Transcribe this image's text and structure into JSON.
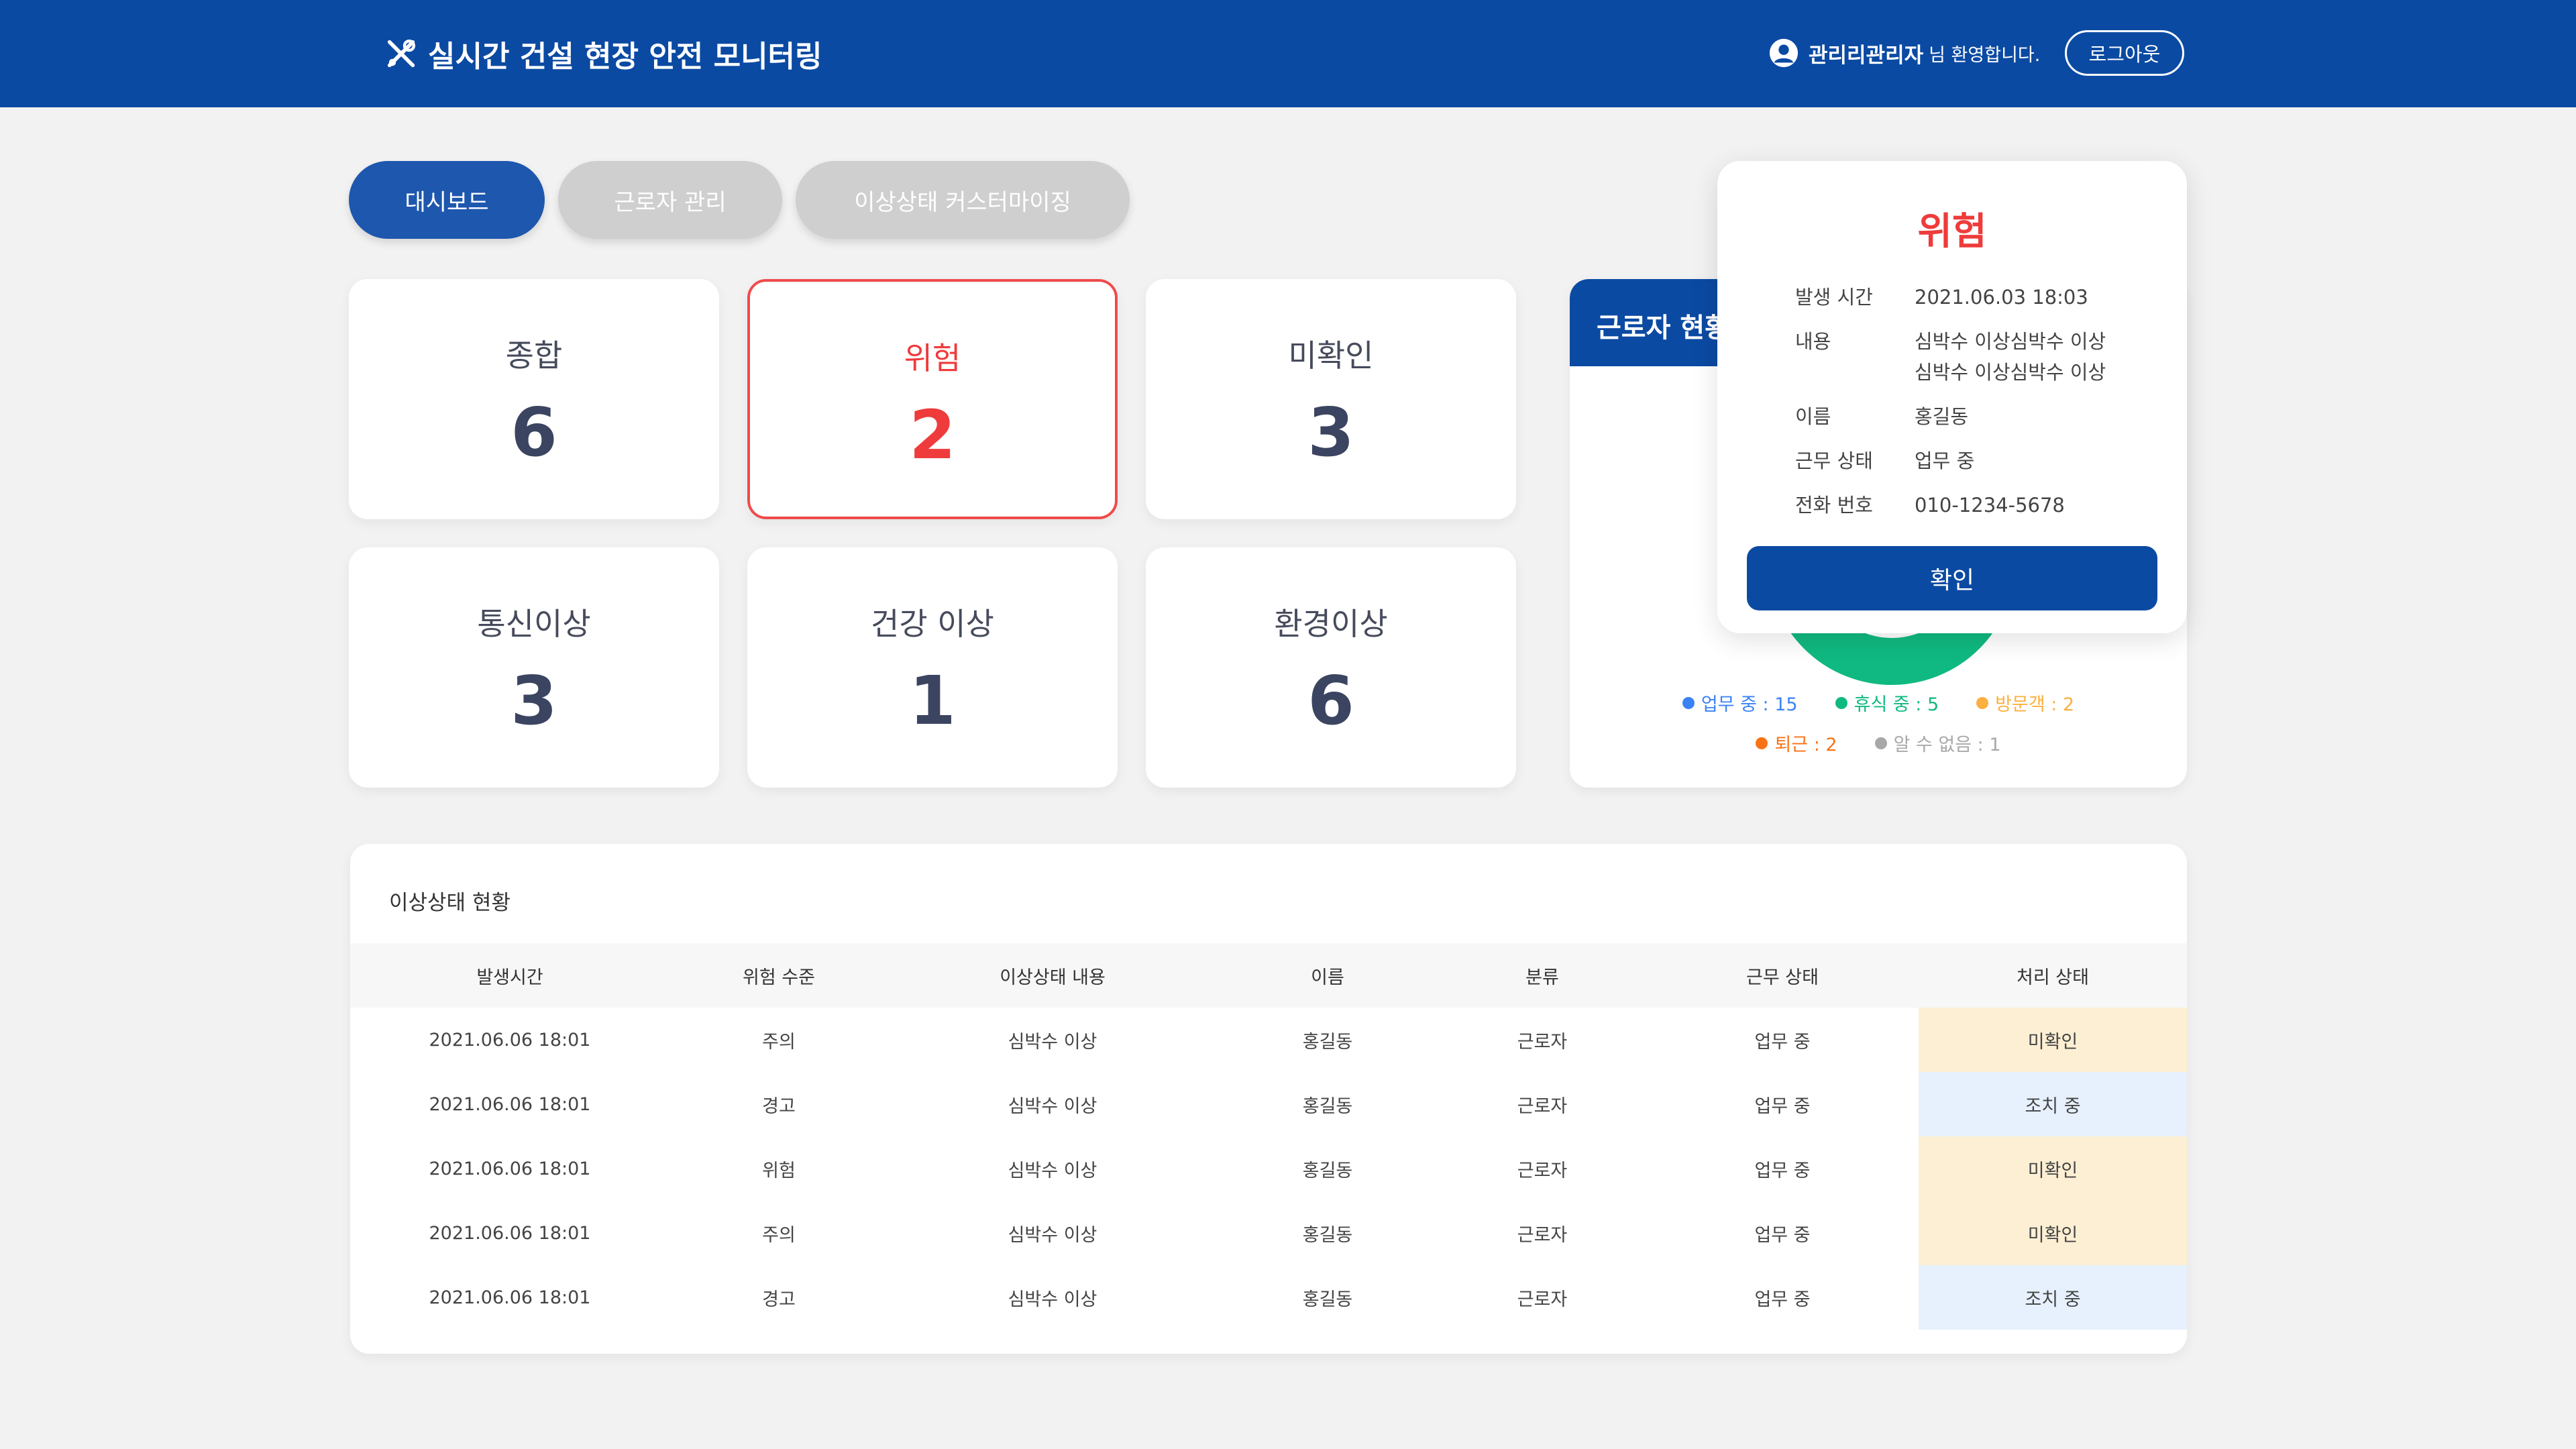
{
  "header": {
    "title": "실시간 건설 현장 안전 모니터링",
    "user_name": "관리리관리자",
    "user_suffix": "님 환영합니다.",
    "logout_label": "로그아웃"
  },
  "tabs": [
    {
      "label": "대시보드",
      "active": true
    },
    {
      "label": "근로자 관리",
      "active": false
    },
    {
      "label": "이상상태 커스터마이징",
      "active": false
    }
  ],
  "stats": [
    {
      "label": "종합",
      "value": "6"
    },
    {
      "label": "위험",
      "value": "2"
    },
    {
      "label": "미확인",
      "value": "3"
    },
    {
      "label": "통신이상",
      "value": "3"
    },
    {
      "label": "건강 이상",
      "value": "1"
    },
    {
      "label": "환경이상",
      "value": "6"
    }
  ],
  "worker_status": {
    "title": "근로자 현황",
    "legend": [
      {
        "label": "업무 중 : 15",
        "color": "#3b82f6"
      },
      {
        "label": "휴식 중 : 5",
        "color": "#10b981"
      },
      {
        "label": "방문객 : 2",
        "color": "#fbb040"
      },
      {
        "label": "퇴근 : 2",
        "color": "#f97316"
      },
      {
        "label": "알 수 없음 : 1",
        "color": "#a8a8a8"
      }
    ]
  },
  "popup": {
    "title": "위험",
    "rows": [
      {
        "key": "발생 시간",
        "value": "2021.06.03 18:03"
      },
      {
        "key": "내용",
        "value": "심박수 이상심박수 이상",
        "value2": "심박수 이상심박수 이상"
      },
      {
        "key": "이름",
        "value": "홍길동"
      },
      {
        "key": "근무 상태",
        "value": "업무 중"
      },
      {
        "key": "전화 번호",
        "value": "010-1234-5678"
      }
    ],
    "confirm_label": "확인"
  },
  "anomaly": {
    "title": "이상상태 현황",
    "columns": [
      "발생시간",
      "위험 수준",
      "이상상태 내용",
      "이름",
      "분류",
      "근무 상태",
      "처리 상태"
    ],
    "rows": [
      [
        "2021.06.06 18:01",
        "주의",
        "심박수 이상",
        "홍길동",
        "근로자",
        "업무 중",
        "미확인"
      ],
      [
        "2021.06.06 18:01",
        "경고",
        "심박수 이상",
        "홍길동",
        "근로자",
        "업무 중",
        "조치 중"
      ],
      [
        "2021.06.06 18:01",
        "위험",
        "심박수 이상",
        "홍길동",
        "근로자",
        "업무 중",
        "미확인"
      ],
      [
        "2021.06.06 18:01",
        "주의",
        "심박수 이상",
        "홍길동",
        "근로자",
        "업무 중",
        "미확인"
      ],
      [
        "2021.06.06 18:01",
        "경고",
        "심박수 이상",
        "홍길동",
        "근로자",
        "업무 중",
        "조치 중"
      ]
    ]
  },
  "colors": {
    "primary": "#0b4aa2",
    "danger": "#ef3b3b",
    "warning": "#f09c00",
    "unchecked_bg": "#fdefd4",
    "processing_bg": "#e7f1fd"
  }
}
